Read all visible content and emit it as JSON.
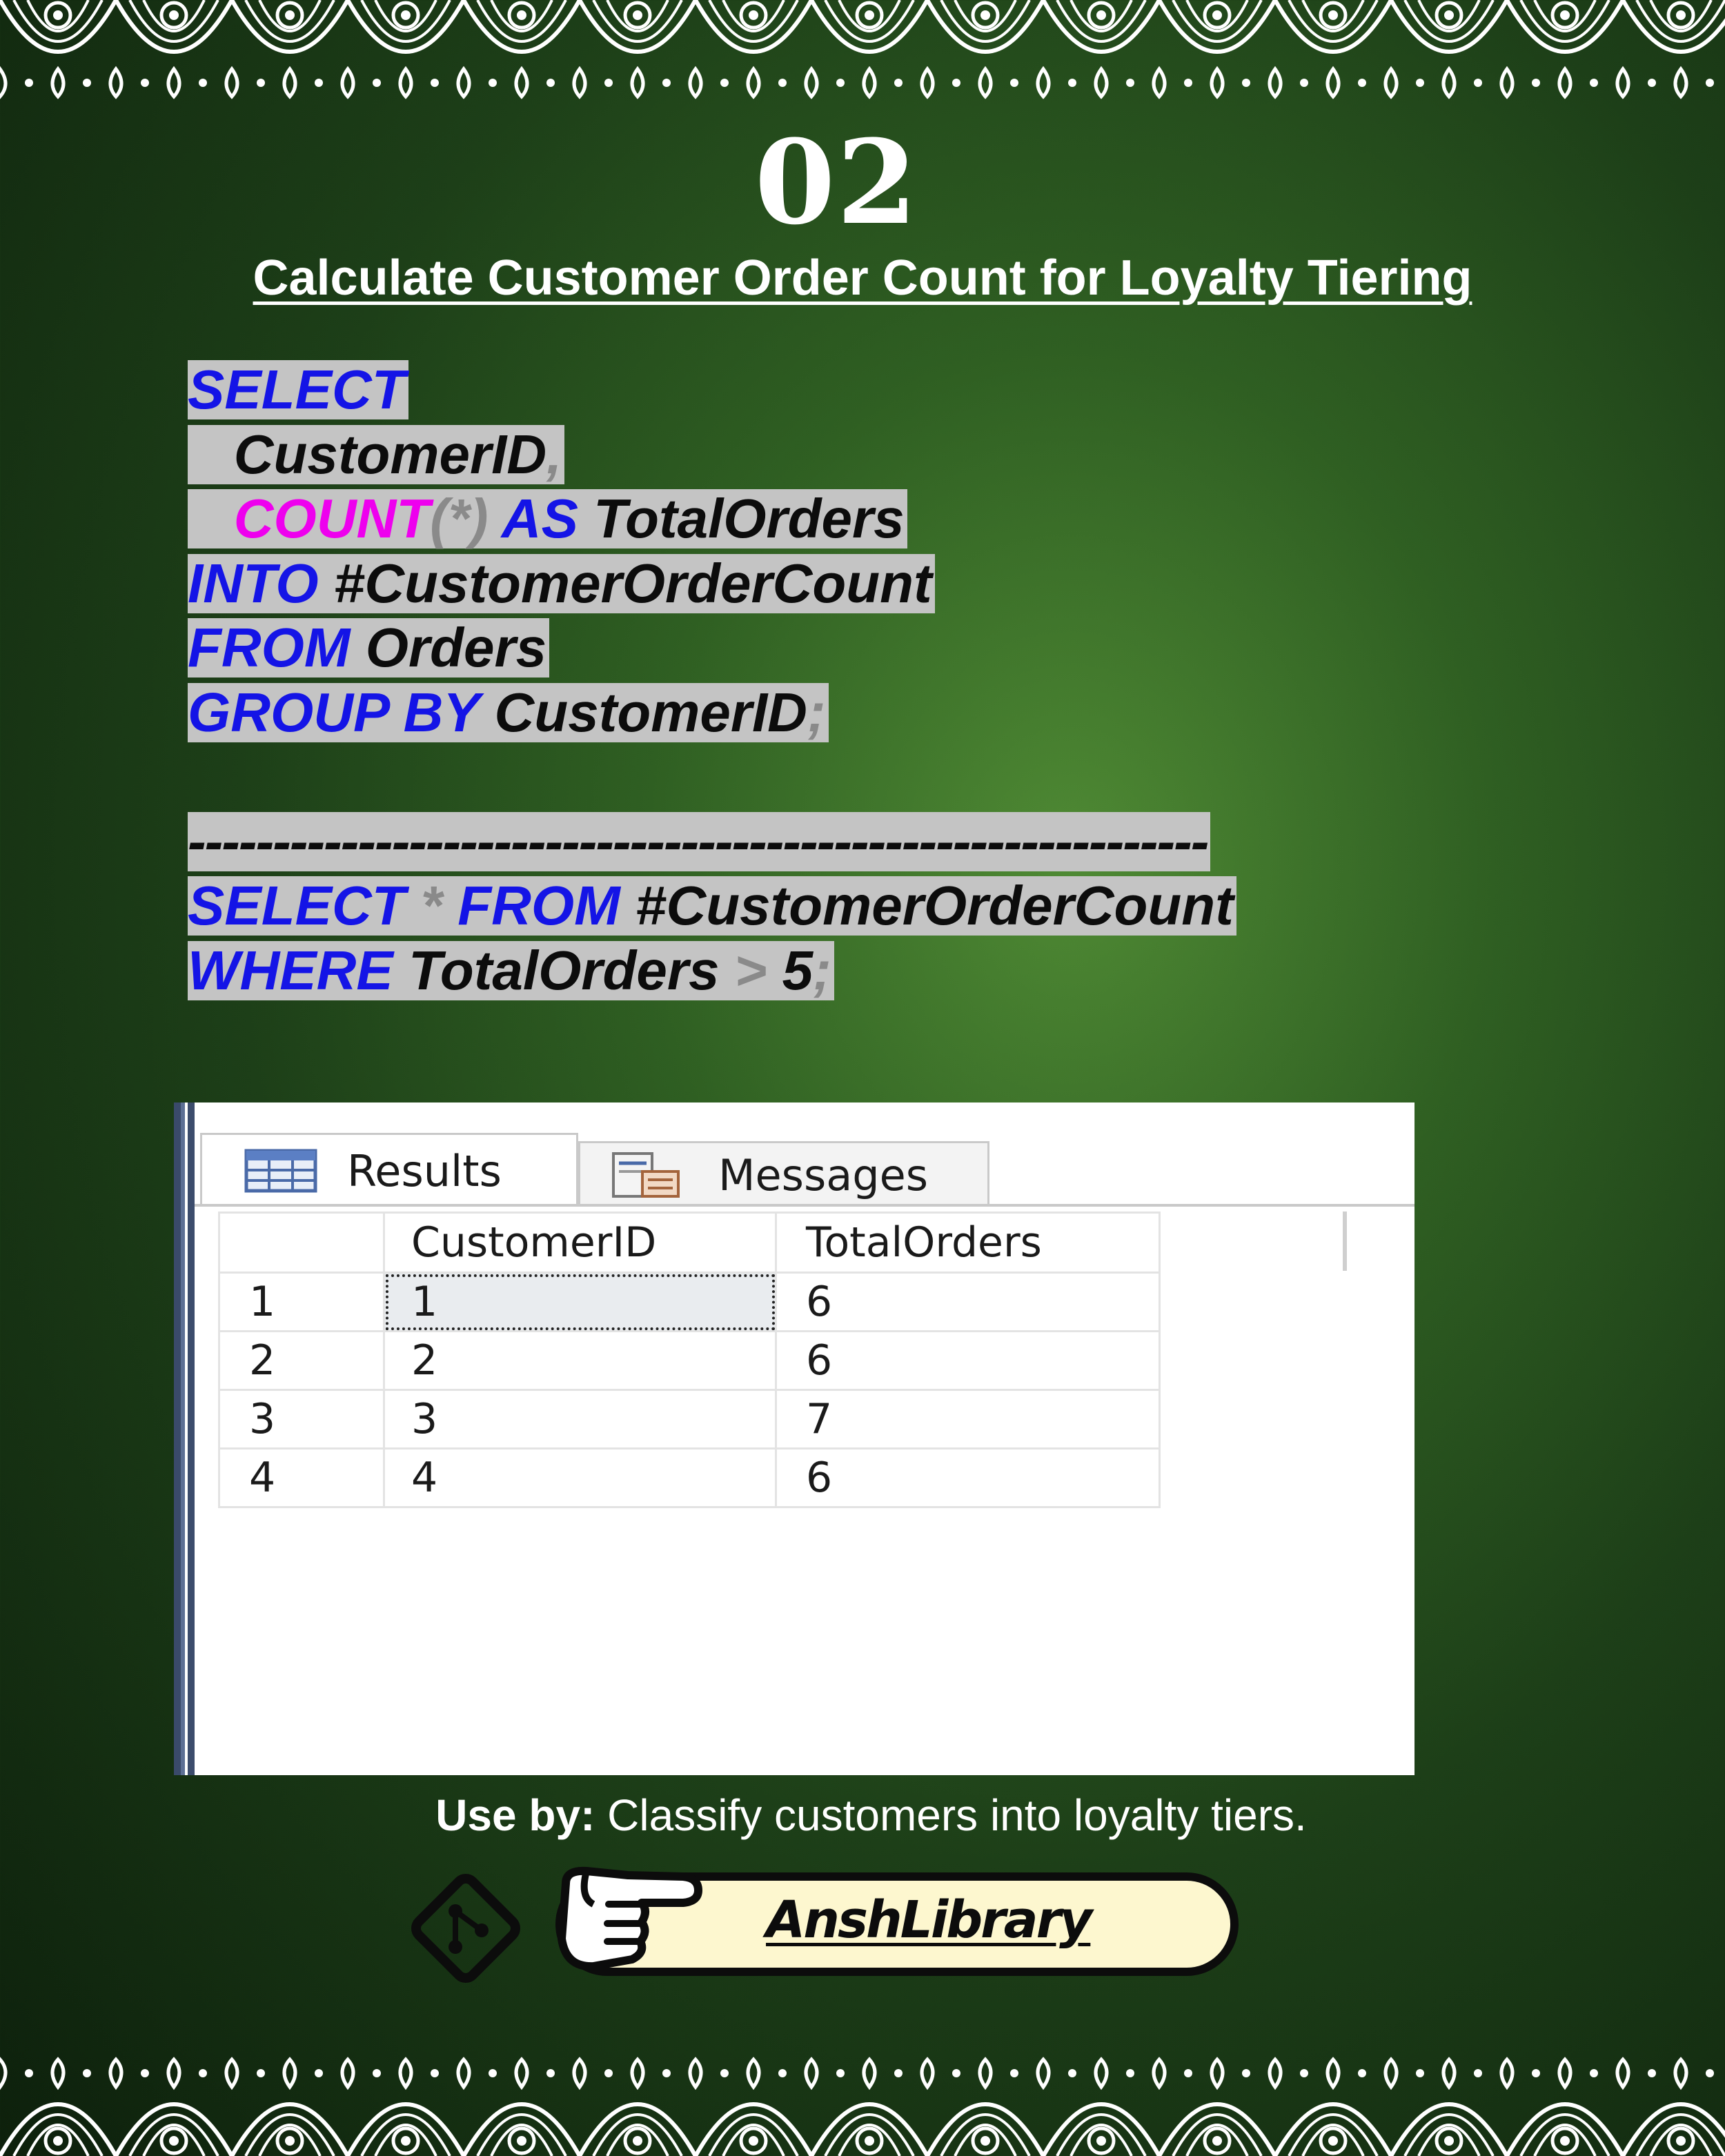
{
  "header": {
    "number": "02",
    "title": "Calculate Customer Order Count for Loyalty Tiering"
  },
  "code": {
    "line1": {
      "kw": "SELECT"
    },
    "line2": {
      "indent": "   ",
      "id": "CustomerID",
      "op": ","
    },
    "line3": {
      "indent": "   ",
      "fn": "COUNT",
      "op": "(*)",
      "kw": "AS",
      "id": "TotalOrders"
    },
    "line4": {
      "kw": "INTO",
      "id": "#CustomerOrderCount"
    },
    "line5": {
      "kw": "FROM",
      "id": "Orders"
    },
    "line6": {
      "kw": "GROUP BY",
      "id": "CustomerID",
      "op": ";"
    },
    "separator": "------------------------------------------------------------",
    "line8": {
      "kw1": "SELECT",
      "op": "*",
      "kw2": "FROM",
      "id": "#CustomerOrderCount"
    },
    "line9": {
      "kw": "WHERE",
      "id": "TotalOrders",
      "op": ">",
      "num": "5",
      "op2": ";"
    }
  },
  "results_panel": {
    "tabs": [
      {
        "label": "Results",
        "icon": "grid-icon"
      },
      {
        "label": "Messages",
        "icon": "messages-icon"
      }
    ],
    "columns": [
      "",
      "CustomerID",
      "TotalOrders"
    ],
    "rows": [
      [
        "1",
        "1",
        "6"
      ],
      [
        "2",
        "2",
        "6"
      ],
      [
        "3",
        "3",
        "7"
      ],
      [
        "4",
        "4",
        "6"
      ]
    ]
  },
  "footer": {
    "use_by_label": "Use by:",
    "use_by_text": "Classify customers into loyalty tiers.",
    "brand": "AnshLibrary"
  },
  "colors": {
    "keyword": "#1414e6",
    "function": "#ee00ee",
    "operator": "#8a8a8a",
    "code_highlight": "#c4c4c4",
    "background": "#1d3f18",
    "pill": "#fdf7cf"
  }
}
